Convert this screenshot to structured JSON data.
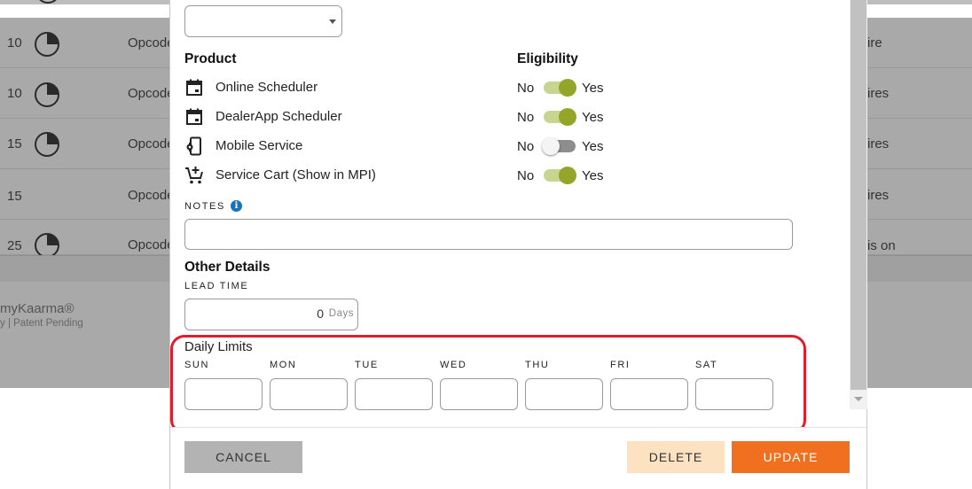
{
  "background": {
    "rows": [
      {
        "num": "10",
        "opcode": "Opcode",
        "right": "ire",
        "clock": true
      },
      {
        "num": "10",
        "opcode": "Opcode",
        "right": "ires",
        "clock": true
      },
      {
        "num": "15",
        "opcode": "Opcode",
        "right": "ires",
        "clock": true
      },
      {
        "num": "15",
        "opcode": "Opcode",
        "right": "ires",
        "clock": false
      },
      {
        "num": "25",
        "opcode": "Opcode",
        "right": "is on",
        "clock": true
      }
    ],
    "brand": "myKaarma®",
    "legal": "y  |  Patent Pending"
  },
  "modal": {
    "select_value": "",
    "product_heading": "Product",
    "eligibility_heading": "Eligibility",
    "products": [
      {
        "label": "Online Scheduler",
        "icon": "calendar-icon",
        "eligible": true
      },
      {
        "label": "DealerApp Scheduler",
        "icon": "calendar-icon",
        "eligible": true
      },
      {
        "label": "Mobile Service",
        "icon": "mobile-service-icon",
        "eligible": false
      },
      {
        "label": "Service Cart (Show in MPI)",
        "icon": "cart-add-icon",
        "eligible": true
      }
    ],
    "no_label": "No",
    "yes_label": "Yes",
    "notes_label": "NOTES",
    "notes_value": "",
    "other_details_heading": "Other Details",
    "lead_time_label": "LEAD TIME",
    "lead_time_value": "0",
    "lead_time_unit": "Days",
    "daily_limits_heading": "Daily Limits",
    "days": [
      "SUN",
      "MON",
      "TUE",
      "WED",
      "THU",
      "FRI",
      "SAT"
    ],
    "buttons": {
      "cancel": "CANCEL",
      "delete": "DELETE",
      "update": "UPDATE"
    }
  },
  "colors": {
    "toggle_on": "#93a62a",
    "update_button": "#f07020",
    "delete_button": "#fde2c1",
    "highlight": "#e11d2d",
    "info_icon": "#1a73b8"
  }
}
